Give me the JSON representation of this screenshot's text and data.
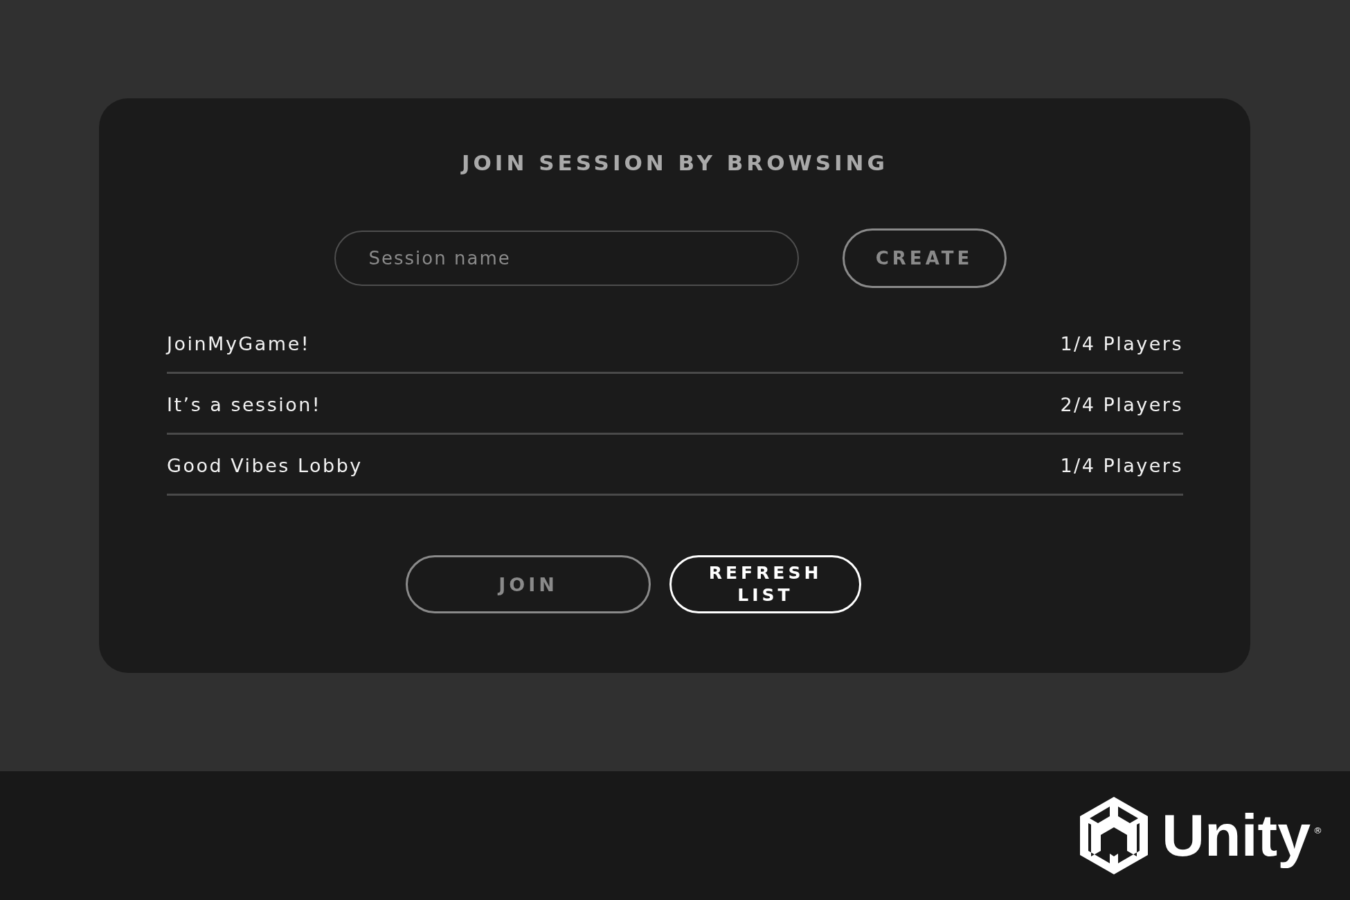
{
  "panel": {
    "title": "JOIN SESSION BY BROWSING"
  },
  "session_field": {
    "placeholder": "Session name"
  },
  "create_button": {
    "label": "CREATE",
    "disabled": true
  },
  "sessions": [
    {
      "name": "JoinMyGame!",
      "players": "1/4 Players"
    },
    {
      "name": "It’s a session!",
      "players": "2/4 Players"
    },
    {
      "name": "Good Vibes Lobby",
      "players": "1/4 Players"
    }
  ],
  "buttons": [
    {
      "label": "JOIN",
      "disabled": true
    },
    {
      "label": "REFRESH LIST",
      "disabled": false
    }
  ],
  "footer": {
    "logo_text": "Unity",
    "trademark": "®"
  }
}
